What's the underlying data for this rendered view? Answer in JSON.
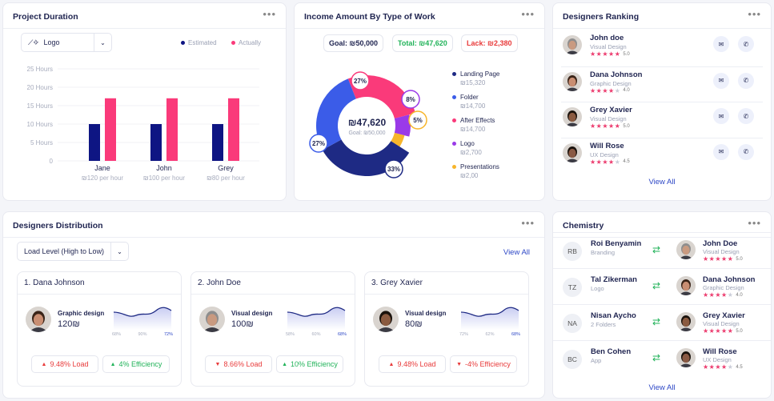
{
  "project_duration": {
    "title": "Project Duration",
    "dropdown": "Logo",
    "legend_estimated": "Estimated",
    "legend_actually": "Actually",
    "colors": {
      "estimated": "#0e1583",
      "actually": "#fa3a7a"
    },
    "chart_data": {
      "type": "bar",
      "categories": [
        "Jane",
        "John",
        "Grey"
      ],
      "sublabels": [
        "₪120 per hour",
        "₪100 per hour",
        "₪80 per hour"
      ],
      "series": [
        {
          "name": "Estimated",
          "values": [
            10,
            10,
            10
          ]
        },
        {
          "name": "Actually",
          "values": [
            17,
            17,
            17
          ]
        }
      ],
      "y_ticks": [
        "25 Hours",
        "20 Hours",
        "15 Hours",
        "10 Hours",
        "5 Hours",
        "0"
      ],
      "ylim": [
        0,
        25
      ],
      "grid": true,
      "legend": "top-right"
    }
  },
  "income": {
    "title": "Income Amount By Type of Work",
    "goal": "Goal: ₪50,000",
    "total": "Total: ₪47,620",
    "lack": "Lack: ₪2,380",
    "center_value": "₪47,620",
    "center_sub": "Goal: ₪50,000",
    "chart_data": {
      "type": "pie",
      "slices": [
        {
          "label": "27%",
          "value": 27,
          "color": "#fa3a7a"
        },
        {
          "label": "8%",
          "value": 8,
          "color": "#9a3ae8"
        },
        {
          "label": "5%",
          "value": 5,
          "color": "#f7b52b"
        },
        {
          "label": "33%",
          "value": 33,
          "color": "#1e2a84"
        },
        {
          "label": "27%",
          "value": 27,
          "color": "#3b5ce8"
        }
      ]
    },
    "legend": [
      {
        "name": "Landing Page",
        "value": "₪15,320",
        "color": "#1e2a84"
      },
      {
        "name": "Folder",
        "value": "₪14,700",
        "color": "#3b5ce8"
      },
      {
        "name": "After Effects",
        "value": "₪14,700",
        "color": "#fa3a7a"
      },
      {
        "name": "Logo",
        "value": "₪2,700",
        "color": "#9a3ae8"
      },
      {
        "name": "Presentations",
        "value": "₪2,00",
        "color": "#f7b52b"
      }
    ]
  },
  "ranking": {
    "title": "Designers Ranking",
    "view_all": "View All",
    "items": [
      {
        "name": "John doe",
        "role": "Visual Design",
        "stars": 5,
        "rating": "5.0",
        "skin": "#c99a80",
        "hair": "#8e8e8e"
      },
      {
        "name": "Dana Johnson",
        "role": "Graphic Design",
        "stars": 4,
        "rating": "4.0",
        "skin": "#c98e72",
        "hair": "#3a2418"
      },
      {
        "name": "Grey Xavier",
        "role": "Visual Design",
        "stars": 5,
        "rating": "5.0",
        "skin": "#8a5a40",
        "hair": "#1a120c"
      },
      {
        "name": "Will Rose",
        "role": "UX Design",
        "stars": 4,
        "rating": "4.5",
        "skin": "#8a5a44",
        "hair": "#1a120c"
      }
    ]
  },
  "distribution": {
    "title": "Designers Distribution",
    "dropdown": "Load Level (High to Low)",
    "view_all": "View All",
    "cards": [
      {
        "title": "1. Dana Johnson",
        "role": "Graphic design",
        "amount": "120₪",
        "ticks": [
          "68%",
          "90%",
          "72%"
        ],
        "load": "9.48% Load",
        "load_dir": "up",
        "eff": "4% Efficiency",
        "eff_dir": "up",
        "skin": "#c98e72",
        "hair": "#3a2418"
      },
      {
        "title": "2. John Doe",
        "role": "Visual design",
        "amount": "100₪",
        "ticks": [
          "58%",
          "60%",
          "68%"
        ],
        "load": "8.66% Load",
        "load_dir": "down",
        "eff": "10% Efficiency",
        "eff_dir": "up",
        "skin": "#c99a80",
        "hair": "#8e8e8e"
      },
      {
        "title": "3. Grey Xavier",
        "role": "Visual design",
        "amount": "80₪",
        "ticks": [
          "72%",
          "62%",
          "68%"
        ],
        "load": "9.48% Load",
        "load_dir": "up",
        "eff": "-4% Efficiency",
        "eff_dir": "down",
        "skin": "#8a5a40",
        "hair": "#1a120c"
      }
    ]
  },
  "chemistry": {
    "title": "Chemistry",
    "view_all": "View All",
    "rows": [
      {
        "initials": "RB",
        "left_name": "Roi Benyamin",
        "left_sub": "Branding",
        "right_name": "John Doe",
        "right_role": "Visual Design",
        "stars": 5,
        "rating": "5.0",
        "skin": "#c99a80",
        "hair": "#8e8e8e"
      },
      {
        "initials": "TZ",
        "left_name": "Tal Zikerman",
        "left_sub": "Logo",
        "right_name": "Dana Johnson",
        "right_role": "Graphic Design",
        "stars": 4,
        "rating": "4.0",
        "skin": "#c98e72",
        "hair": "#3a2418"
      },
      {
        "initials": "NA",
        "left_name": "Nisan Aycho",
        "left_sub": "2 Folders",
        "right_name": "Grey Xavier",
        "right_role": "Visual Design",
        "stars": 5,
        "rating": "5.0",
        "skin": "#8a5a40",
        "hair": "#1a120c"
      },
      {
        "initials": "BC",
        "left_name": "Ben Cohen",
        "left_sub": "App",
        "right_name": "Will Rose",
        "right_role": "UX Design",
        "stars": 4,
        "rating": "4.5",
        "skin": "#8a5a44",
        "hair": "#1a120c"
      }
    ]
  },
  "colors": {
    "brand": "#1f2450",
    "pink": "#ec3b6e",
    "green": "#22b35a",
    "red": "#e83a3a",
    "blue": "#2d47c6"
  }
}
